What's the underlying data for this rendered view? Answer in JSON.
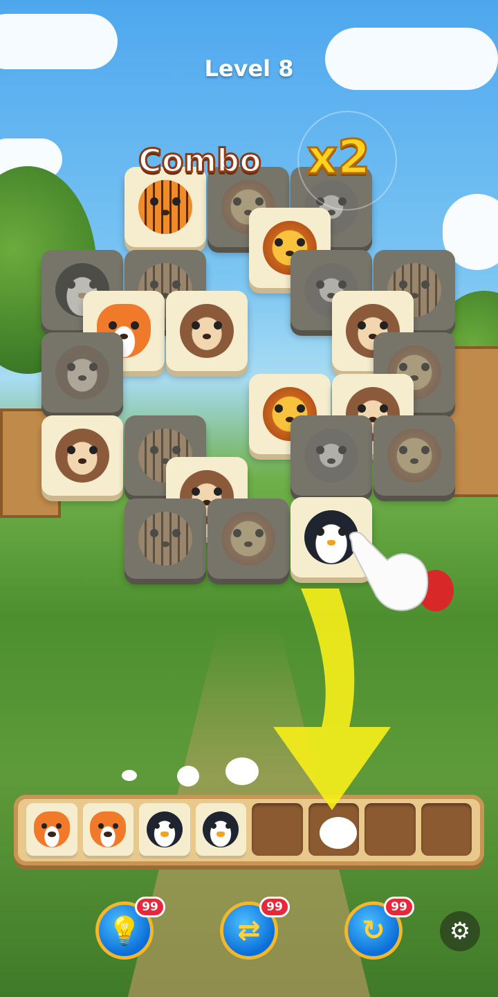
{
  "header": {
    "level_title": "Level 8"
  },
  "combo": {
    "label": "Combo",
    "multiplier": "x2"
  },
  "board": {
    "tiles": [
      {
        "animal": "tiger",
        "state": "active"
      },
      {
        "animal": "lion",
        "state": "dim"
      },
      {
        "animal": "raccoon",
        "state": "dim"
      },
      {
        "animal": "lion",
        "state": "active"
      },
      {
        "animal": "penguin",
        "state": "dim"
      },
      {
        "animal": "tiger",
        "state": "dim"
      },
      {
        "animal": "raccoon",
        "state": "dim"
      },
      {
        "animal": "tiger",
        "state": "dim"
      },
      {
        "animal": "fox",
        "state": "active"
      },
      {
        "animal": "sloth",
        "state": "active"
      },
      {
        "animal": "sloth",
        "state": "active"
      },
      {
        "animal": "sloth",
        "state": "dim"
      },
      {
        "animal": "lion",
        "state": "dim"
      },
      {
        "animal": "lion",
        "state": "active"
      },
      {
        "animal": "sloth",
        "state": "active"
      },
      {
        "animal": "sloth",
        "state": "active"
      },
      {
        "animal": "tiger",
        "state": "dim"
      },
      {
        "animal": "raccoon",
        "state": "dim"
      },
      {
        "animal": "lion",
        "state": "dim"
      },
      {
        "animal": "sloth",
        "state": "active"
      },
      {
        "animal": "tiger",
        "state": "dim"
      },
      {
        "animal": "lion",
        "state": "dim"
      },
      {
        "animal": "penguin",
        "state": "active"
      }
    ]
  },
  "tray": {
    "slots": [
      "fox",
      "fox",
      "penguin",
      "penguin",
      "",
      "",
      "",
      ""
    ]
  },
  "tools": [
    {
      "name": "hint",
      "icon": "lightbulb-icon",
      "glyph": "💡",
      "count": "99"
    },
    {
      "name": "shuffle",
      "icon": "shuffle-icon",
      "glyph": "⇄",
      "count": "99"
    },
    {
      "name": "undo",
      "icon": "redo-arrow-icon",
      "glyph": "↻",
      "count": "99"
    }
  ],
  "settings": {
    "icon": "gear-icon",
    "glyph": "⚙"
  }
}
